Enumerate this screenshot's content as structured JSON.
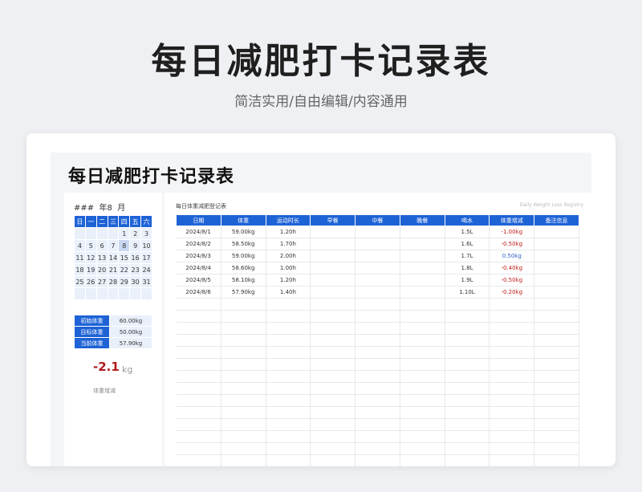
{
  "hero": {
    "title": "每日减肥打卡记录表",
    "subtitle": "简洁实用/自由编辑/内容通用"
  },
  "sheet": {
    "title": "每日减肥打卡记录表"
  },
  "calendar": {
    "header": "###  年8  月",
    "weekdays": [
      "日",
      "一",
      "二",
      "三",
      "四",
      "五",
      "六"
    ],
    "weeks": [
      [
        "",
        "",
        "",
        "",
        "1",
        "2",
        "3"
      ],
      [
        "4",
        "5",
        "6",
        "7",
        "8",
        "9",
        "10"
      ],
      [
        "11",
        "12",
        "13",
        "14",
        "15",
        "16",
        "17"
      ],
      [
        "18",
        "19",
        "20",
        "21",
        "22",
        "23",
        "24"
      ],
      [
        "25",
        "26",
        "27",
        "28",
        "29",
        "30",
        "31"
      ],
      [
        "",
        "",
        "",
        "",
        "",
        "",
        ""
      ]
    ],
    "selected": "8"
  },
  "stats": [
    {
      "label": "初始体重",
      "value": "60.00kg"
    },
    {
      "label": "目标体重",
      "value": "50.00kg"
    },
    {
      "label": "当前体重",
      "value": "57.90kg"
    }
  ],
  "summary": {
    "change": "-2.1",
    "unit": "kg",
    "label": "体重增减"
  },
  "log": {
    "title": "每日体重减肥登记表",
    "subtitle": "Daily Weight Loss Registry",
    "columns": [
      "日期",
      "体重",
      "运动时长",
      "早餐",
      "中餐",
      "晚餐",
      "喝水",
      "体重增减",
      "备注信息"
    ],
    "rows": [
      {
        "date": "2024/8/1",
        "weight": "59.00kg",
        "exercise": "1.20h",
        "breakfast": "",
        "lunch": "",
        "dinner": "",
        "water": "1.5L",
        "delta": "-1.00kg",
        "sign": "neg",
        "note": ""
      },
      {
        "date": "2024/8/2",
        "weight": "58.50kg",
        "exercise": "1.70h",
        "breakfast": "",
        "lunch": "",
        "dinner": "",
        "water": "1.6L",
        "delta": "-0.50kg",
        "sign": "neg",
        "note": ""
      },
      {
        "date": "2024/8/3",
        "weight": "59.00kg",
        "exercise": "2.00h",
        "breakfast": "",
        "lunch": "",
        "dinner": "",
        "water": "1.7L",
        "delta": "0.50kg",
        "sign": "pos",
        "note": ""
      },
      {
        "date": "2024/8/4",
        "weight": "58.60kg",
        "exercise": "1.00h",
        "breakfast": "",
        "lunch": "",
        "dinner": "",
        "water": "1.8L",
        "delta": "-0.40kg",
        "sign": "neg",
        "note": ""
      },
      {
        "date": "2024/8/5",
        "weight": "58.10kg",
        "exercise": "1.20h",
        "breakfast": "",
        "lunch": "",
        "dinner": "",
        "water": "1.9L",
        "delta": "-0.50kg",
        "sign": "neg",
        "note": ""
      },
      {
        "date": "2024/8/6",
        "weight": "57.90kg",
        "exercise": "1.40h",
        "breakfast": "",
        "lunch": "",
        "dinner": "",
        "water": "1.10L",
        "delta": "-0.20kg",
        "sign": "neg",
        "note": ""
      }
    ],
    "empty_rows": 14
  },
  "colors": {
    "accent": "#1e63d6",
    "negative": "#c21a1a",
    "positive": "#2a62c9"
  }
}
